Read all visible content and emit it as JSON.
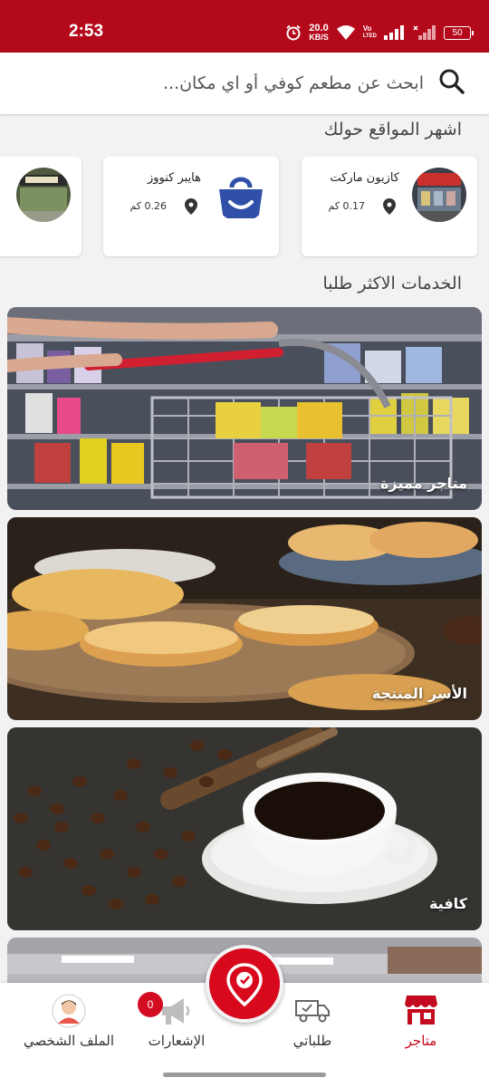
{
  "status_bar": {
    "time": "2:53",
    "net_speed_value": "20.0",
    "net_speed_unit": "KB/S",
    "volte_top": "Vo",
    "volte_bottom": "LTED",
    "battery": "50"
  },
  "search": {
    "placeholder": "ابحث عن مطعم كوفي أو اي مكان..."
  },
  "popular_places": {
    "title": "اشهر المواقع حولك",
    "items": [
      {
        "name": "كازيون ماركت",
        "distance": "0.17 كم"
      },
      {
        "name": "هايبر كنووز",
        "distance": "0.26 كم"
      },
      {
        "name": "",
        "distance": ""
      }
    ]
  },
  "top_services": {
    "title": "الخدمات الاكثر طلبا",
    "items": [
      {
        "label": "متاجر مميزة"
      },
      {
        "label": "الأسر المنتجة"
      },
      {
        "label": "كافية"
      },
      {
        "label": ""
      }
    ]
  },
  "bottom_nav": {
    "profile": "الملف الشخصي",
    "notifications": "الإشعارات",
    "notifications_count": "0",
    "orders": "طلباتي",
    "stores": "متاجر"
  },
  "colors": {
    "brand": "#b4091b",
    "accent": "#d8081d",
    "store_icon": "#c30a1e"
  }
}
